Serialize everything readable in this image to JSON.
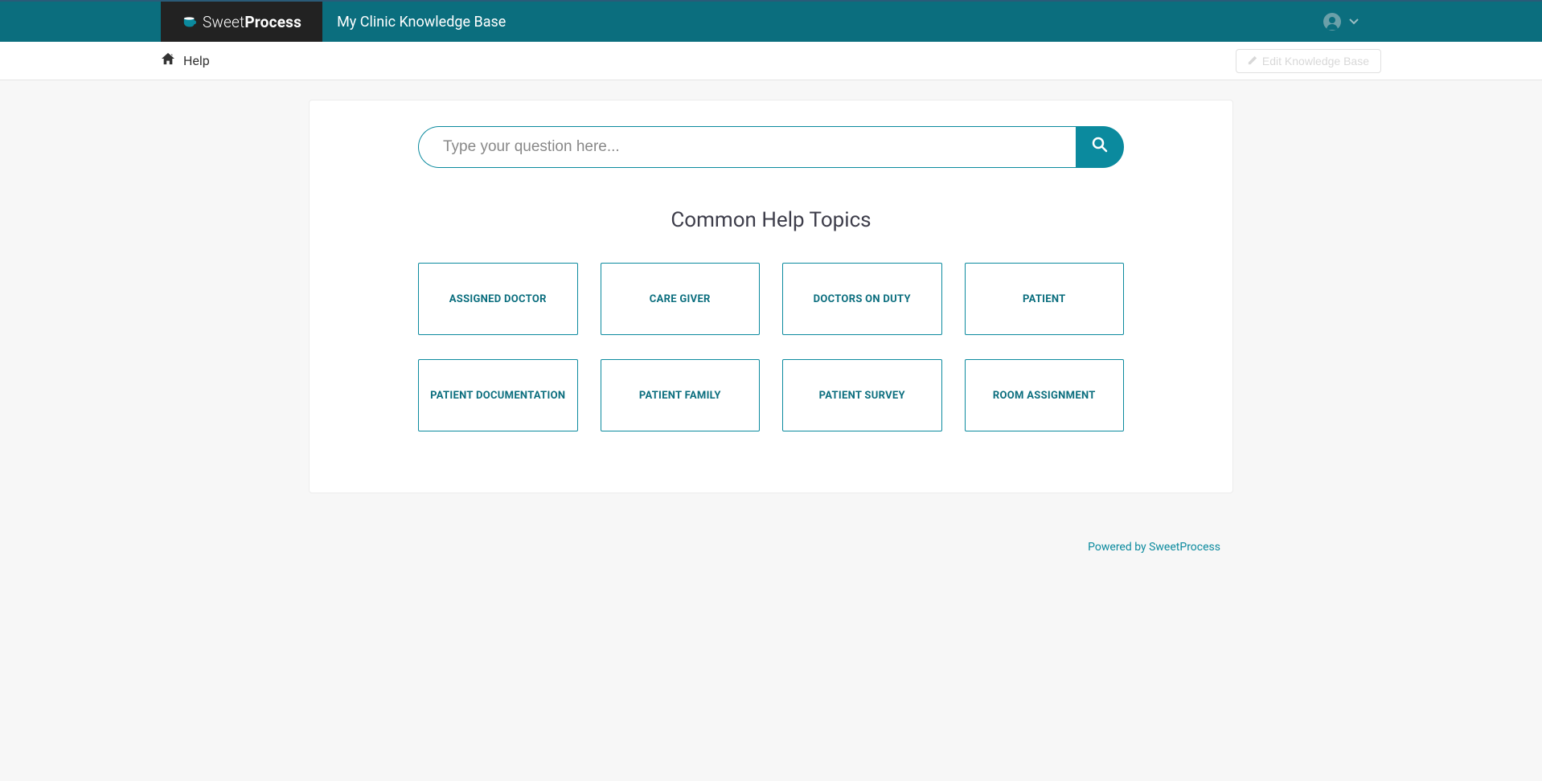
{
  "header": {
    "brand_prefix": "Sweet",
    "brand_suffix": "Process",
    "title": "My Clinic Knowledge Base"
  },
  "subheader": {
    "breadcrumb_label": "Help",
    "edit_button_label": "Edit Knowledge Base"
  },
  "search": {
    "placeholder": "Type your question here..."
  },
  "topics": {
    "heading": "Common Help Topics",
    "items": [
      {
        "label": "ASSIGNED DOCTOR"
      },
      {
        "label": "CARE GIVER"
      },
      {
        "label": "DOCTORS ON DUTY"
      },
      {
        "label": "PATIENT"
      },
      {
        "label": "PATIENT DOCUMENTATION"
      },
      {
        "label": "PATIENT FAMILY"
      },
      {
        "label": "PATIENT SURVEY"
      },
      {
        "label": "ROOM ASSIGNMENT"
      }
    ]
  },
  "footer": {
    "powered_by": "Powered by SweetProcess"
  }
}
